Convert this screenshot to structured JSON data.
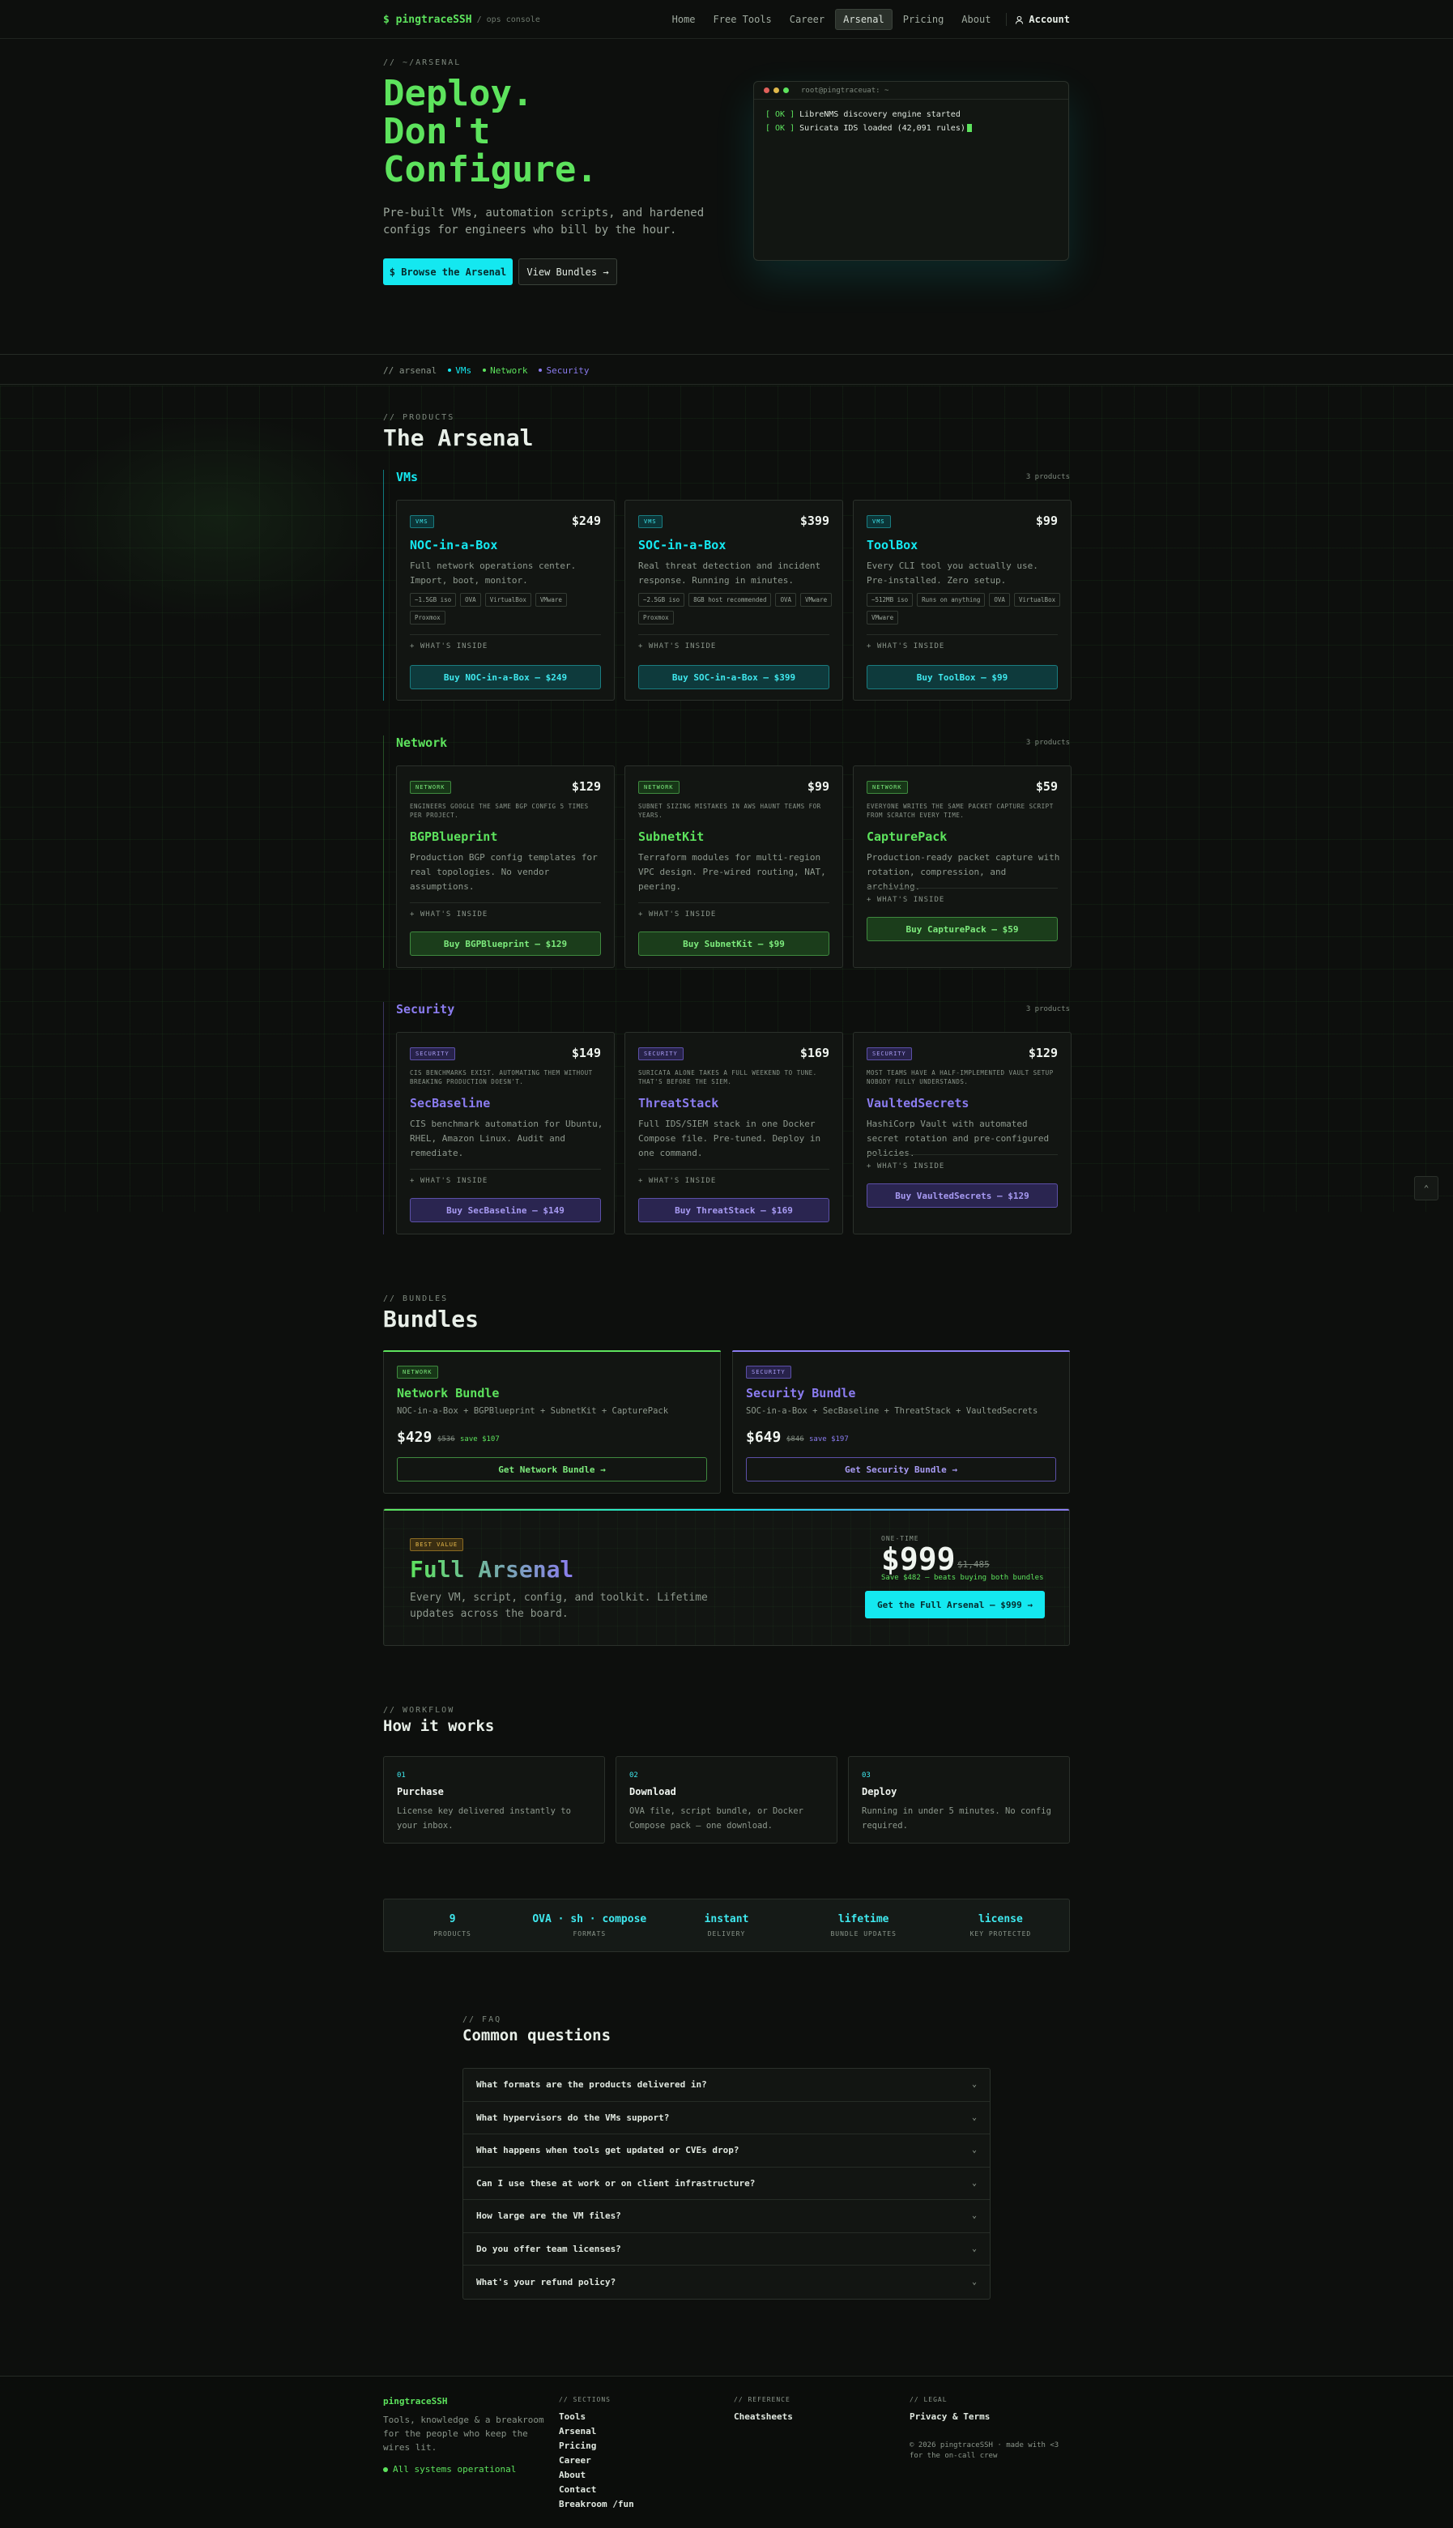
{
  "colors": {
    "accent_green": "#5de35d",
    "accent_cyan": "#14e8f0",
    "accent_purple": "#8b7cf0",
    "background": "#0d0f0d"
  },
  "nav": {
    "brand": "$ pingtraceSSH",
    "brand_sub": "/ ops console",
    "links": [
      "Home",
      "Free Tools",
      "Career",
      "Arsenal",
      "Pricing",
      "About"
    ],
    "active": "Arsenal",
    "account": "Account",
    "account_icon": "user-icon"
  },
  "hero": {
    "eyebrow": "// ~/ARSENAL",
    "title_lines": [
      "Deploy.",
      "Don't",
      "Configure."
    ],
    "description": "Pre-built VMs, automation scripts, and hardened configs for engineers who bill by the hour.",
    "primary_button": "$ Browse the Arsenal",
    "secondary_button": "View Bundles →",
    "terminal": {
      "title": "root@pingtraceuat: ~",
      "lines": [
        {
          "status": "[ OK ]",
          "text": "LibreNMS discovery engine started"
        },
        {
          "status": "[ OK ]",
          "text": "Suricata IDS loaded (42,091 rules)"
        }
      ]
    }
  },
  "strip": {
    "label": "// arsenal",
    "items": [
      {
        "label": "VMs",
        "color": "#14e8f0"
      },
      {
        "label": "Network",
        "color": "#5de35d"
      },
      {
        "label": "Security",
        "color": "#8b7cf0"
      }
    ]
  },
  "products": {
    "eyebrow": "// PRODUCTS",
    "title": "The Arsenal",
    "whats_inside": "+ WHAT'S INSIDE",
    "categories": [
      {
        "name": "VMs",
        "count": "3 products",
        "tag": "VMS",
        "items": [
          {
            "name": "NOC-in-a-Box",
            "price": "$249",
            "description": "Full network operations center. Import, boot, monitor.",
            "chips": [
              "~1.5GB iso",
              "OVA",
              "VirtualBox",
              "VMware",
              "Proxmox"
            ],
            "buy": "Buy NOC-in-a-Box — $249"
          },
          {
            "name": "SOC-in-a-Box",
            "price": "$399",
            "description": "Real threat detection and incident response. Running in minutes.",
            "chips": [
              "~2.5GB iso",
              "8GB host recommended",
              "OVA",
              "VMware",
              "Proxmox"
            ],
            "buy": "Buy SOC-in-a-Box — $399"
          },
          {
            "name": "ToolBox",
            "price": "$99",
            "description": "Every CLI tool you actually use. Pre-installed. Zero setup.",
            "chips": [
              "~512MB iso",
              "Runs on anything",
              "OVA",
              "VirtualBox",
              "VMware"
            ],
            "buy": "Buy ToolBox — $99"
          }
        ]
      },
      {
        "name": "Network",
        "count": "3 products",
        "tag": "NETWORK",
        "items": [
          {
            "name": "BGPBlueprint",
            "price": "$129",
            "note": "ENGINEERS GOOGLE THE SAME BGP CONFIG 5 TIMES PER PROJECT.",
            "description": "Production BGP config templates for real topologies. No vendor assumptions.",
            "buy": "Buy BGPBlueprint — $129"
          },
          {
            "name": "SubnetKit",
            "price": "$99",
            "note": "SUBNET SIZING MISTAKES IN AWS HAUNT TEAMS FOR YEARS.",
            "description": "Terraform modules for multi-region VPC design. Pre-wired routing, NAT, peering.",
            "buy": "Buy SubnetKit — $99"
          },
          {
            "name": "CapturePack",
            "price": "$59",
            "note": "EVERYONE WRITES THE SAME PACKET CAPTURE SCRIPT FROM SCRATCH EVERY TIME.",
            "description": "Production-ready packet capture with rotation, compression, and archiving.",
            "buy": "Buy CapturePack — $59"
          }
        ]
      },
      {
        "name": "Security",
        "count": "3 products",
        "tag": "SECURITY",
        "items": [
          {
            "name": "SecBaseline",
            "price": "$149",
            "note": "CIS BENCHMARKS EXIST. AUTOMATING THEM WITHOUT BREAKING PRODUCTION DOESN'T.",
            "description": "CIS benchmark automation for Ubuntu, RHEL, Amazon Linux. Audit and remediate.",
            "buy": "Buy SecBaseline — $149"
          },
          {
            "name": "ThreatStack",
            "price": "$169",
            "note": "SURICATA ALONE TAKES A FULL WEEKEND TO TUNE. THAT'S BEFORE THE SIEM.",
            "description": "Full IDS/SIEM stack in one Docker Compose file. Pre-tuned. Deploy in one command.",
            "buy": "Buy ThreatStack — $169"
          },
          {
            "name": "VaultedSecrets",
            "price": "$129",
            "note": "MOST TEAMS HAVE A HALF-IMPLEMENTED VAULT SETUP NOBODY FULLY UNDERSTANDS.",
            "description": "HashiCorp Vault with automated secret rotation and pre-configured policies.",
            "buy": "Buy VaultedSecrets — $129"
          }
        ]
      }
    ]
  },
  "bundles": {
    "eyebrow": "// BUNDLES",
    "title": "Bundles",
    "items": [
      {
        "tag": "NETWORK",
        "name": "Network Bundle",
        "items": "NOC-in-a-Box + BGPBlueprint + SubnetKit + CapturePack",
        "price": "$429",
        "old": "$536",
        "save": "save $107",
        "button": "Get Network Bundle →"
      },
      {
        "tag": "SECURITY",
        "name": "Security Bundle",
        "items": "SOC-in-a-Box + SecBaseline + ThreatStack + VaultedSecrets",
        "price": "$649",
        "old": "$846",
        "save": "save $197",
        "button": "Get Security Bundle →"
      }
    ],
    "full": {
      "tag": "BEST VALUE",
      "name": "Full Arsenal",
      "description": "Every VM, script, config, and toolkit. Lifetime updates across the board.",
      "once": "ONE-TIME",
      "price": "$999",
      "old": "$1,485",
      "save": "Save $482 — beats buying both bundles",
      "button": "Get the Full Arsenal — $999 →"
    }
  },
  "how": {
    "eyebrow": "// WORKFLOW",
    "title": "How it works",
    "steps": [
      {
        "num": "01",
        "title": "Purchase",
        "desc": "License key delivered instantly to your inbox."
      },
      {
        "num": "02",
        "title": "Download",
        "desc": "OVA file, script bundle, or Docker Compose pack — one download."
      },
      {
        "num": "03",
        "title": "Deploy",
        "desc": "Running in under 5 minutes. No config required."
      }
    ]
  },
  "stats": [
    {
      "value": "9",
      "label": "PRODUCTS"
    },
    {
      "value": "OVA · sh · compose",
      "label": "FORMATS"
    },
    {
      "value": "instant",
      "label": "DELIVERY"
    },
    {
      "value": "lifetime",
      "label": "BUNDLE UPDATES"
    },
    {
      "value": "license",
      "label": "KEY PROTECTED"
    }
  ],
  "faq": {
    "eyebrow": "// FAQ",
    "title": "Common questions",
    "questions": [
      "What formats are the products delivered in?",
      "What hypervisors do the VMs support?",
      "What happens when tools get updated or CVEs drop?",
      "Can I use these at work or on client infrastructure?",
      "How large are the VM files?",
      "Do you offer team licenses?",
      "What's your refund policy?"
    ]
  },
  "footer": {
    "brand": "pingtraceSSH",
    "tagline": "Tools, knowledge & a breakroom for the people who keep the wires lit.",
    "status": "All systems operational",
    "sections_head": "// SECTIONS",
    "sections": [
      "Tools",
      "Arsenal",
      "Pricing",
      "Career",
      "About",
      "Contact",
      "Breakroom /fun"
    ],
    "reference_head": "// REFERENCE",
    "reference": [
      "Cheatsheets"
    ],
    "legal_head": "// LEGAL",
    "legal": [
      "Privacy & Terms"
    ],
    "copyright": "© 2026 pingtraceSSH · made with <3 for the on-call crew"
  }
}
